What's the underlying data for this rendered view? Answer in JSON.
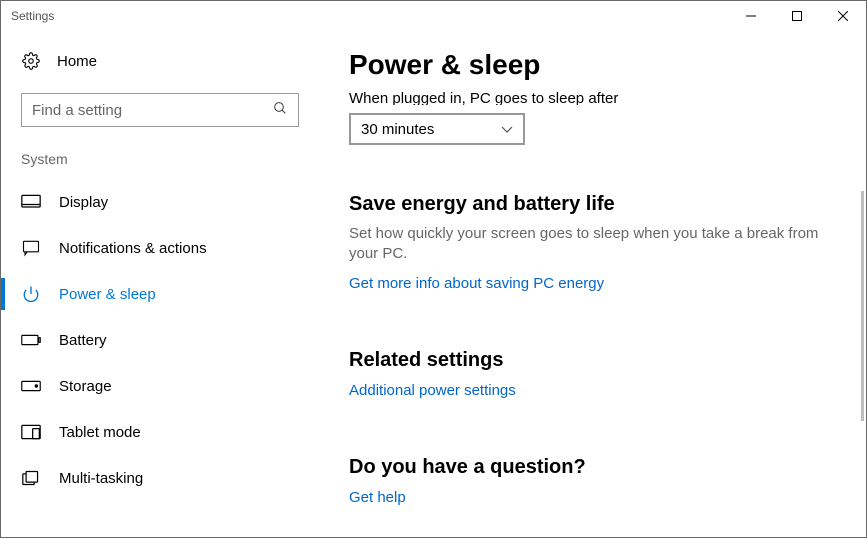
{
  "window": {
    "title": "Settings"
  },
  "sidebar": {
    "home_label": "Home",
    "search_placeholder": "Find a setting",
    "section_label": "System",
    "items": [
      {
        "label": "Display",
        "icon": "display-icon"
      },
      {
        "label": "Notifications & actions",
        "icon": "notifications-icon"
      },
      {
        "label": "Power & sleep",
        "icon": "power-icon",
        "selected": true
      },
      {
        "label": "Battery",
        "icon": "battery-icon"
      },
      {
        "label": "Storage",
        "icon": "storage-icon"
      },
      {
        "label": "Tablet mode",
        "icon": "tablet-icon"
      },
      {
        "label": "Multi-tasking",
        "icon": "multitasking-icon"
      }
    ]
  },
  "content": {
    "page_title": "Power & sleep",
    "sleep_section": {
      "partial_label": "When plugged in, PC goes to sleep after",
      "dropdown_value": "30 minutes"
    },
    "save_energy": {
      "heading": "Save energy and battery life",
      "description": "Set how quickly your screen goes to sleep when you take a break from your PC.",
      "link": "Get more info about saving PC energy"
    },
    "related": {
      "heading": "Related settings",
      "link": "Additional power settings"
    },
    "question": {
      "heading": "Do you have a question?",
      "link": "Get help"
    }
  }
}
